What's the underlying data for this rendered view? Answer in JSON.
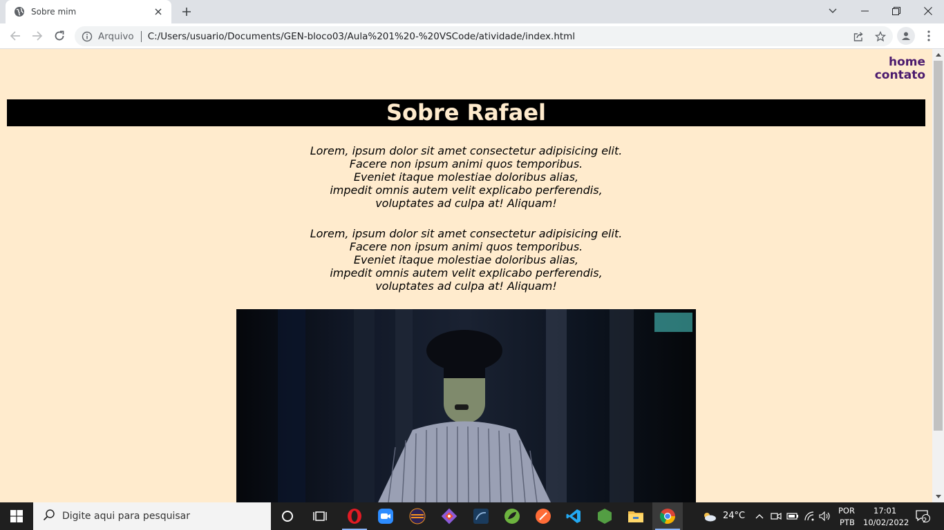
{
  "browser": {
    "tab": {
      "title": "Sobre mim"
    },
    "address": {
      "scheme_label": "Arquivo",
      "url": "C:/Users/usuario/Documents/GEN-bloco03/Aula%201%20-%20VSCode/atividade/index.html"
    }
  },
  "page": {
    "nav": {
      "home": "home",
      "contato": "contato"
    },
    "heading": "Sobre Rafael",
    "paragraphs": [
      {
        "lines": [
          "Lorem, ipsum dolor sit amet consectetur adipisicing elit.",
          "Facere non ipsum animi quos temporibus.",
          "Eveniet itaque molestiae doloribus alias,",
          "impedit omnis autem velit explicabo perferendis,",
          "voluptates ad culpa at! Aliquam!"
        ]
      },
      {
        "lines": [
          "Lorem, ipsum dolor sit amet consectetur adipisicing elit.",
          "Facere non ipsum animi quos temporibus.",
          "Eveniet itaque molestiae doloribus alias,",
          "impedit omnis autem velit explicabo perferendis,",
          "voluptates ad culpa at! Aliquam!"
        ]
      }
    ],
    "colors": {
      "background": "#ffebcd",
      "banner": "#000000",
      "banner_text": "#ffebcd",
      "link": "#4b1a6e"
    }
  },
  "taskbar": {
    "search_placeholder": "Digite aqui para pesquisar",
    "weather": "24°C",
    "language": {
      "line1": "POR",
      "line2": "PTB"
    },
    "clock": {
      "time": "17:01",
      "date": "10/02/2022"
    },
    "notifications": "2",
    "apps": [
      "opera-icon",
      "zoom-icon",
      "eclipse-icon",
      "git-icon",
      "vscode-blue-icon",
      "spring-icon",
      "postman-icon",
      "vscode-icon",
      "node-icon",
      "file-explorer-icon",
      "chrome-icon"
    ]
  }
}
